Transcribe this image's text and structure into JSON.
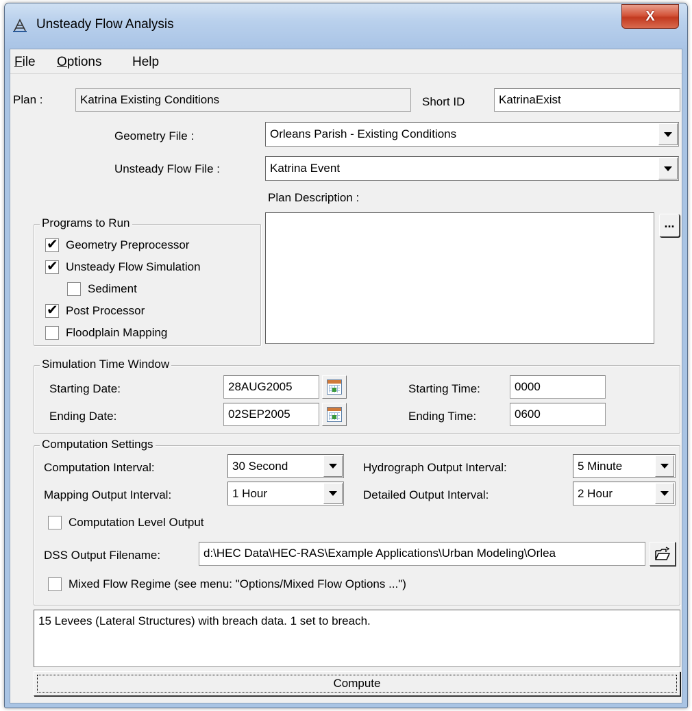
{
  "window": {
    "title": "Unsteady Flow Analysis",
    "close_glyph": "X"
  },
  "menu": {
    "file": "File",
    "options": "Options",
    "help": "Help"
  },
  "plan": {
    "plan_label": "Plan :",
    "plan_value": "Katrina Existing Conditions",
    "short_id_label": "Short ID",
    "short_id_value": "KatrinaExist",
    "geometry_label": "Geometry File :",
    "geometry_value": "Orleans Parish - Existing Conditions",
    "unsteady_label": "Unsteady Flow File :",
    "unsteady_value": "Katrina Event",
    "description_label": "Plan Description :",
    "description_value": "",
    "description_button": "..."
  },
  "programs": {
    "title": "Programs to Run",
    "items": [
      {
        "label": "Geometry Preprocessor",
        "checked": true
      },
      {
        "label": "Unsteady Flow Simulation",
        "checked": true
      },
      {
        "label": "Sediment",
        "checked": false
      },
      {
        "label": "Post Processor",
        "checked": true
      },
      {
        "label": "Floodplain Mapping",
        "checked": false
      }
    ]
  },
  "time_window": {
    "title": "Simulation Time Window",
    "start_date_label": "Starting Date:",
    "start_date": "28AUG2005",
    "end_date_label": "Ending Date:",
    "end_date": "02SEP2005",
    "start_time_label": "Starting Time:",
    "start_time": "0000",
    "end_time_label": "Ending Time:",
    "end_time": "0600"
  },
  "computation": {
    "title": "Computation Settings",
    "comp_interval_label": "Computation Interval:",
    "comp_interval": "30 Second",
    "hydro_interval_label": "Hydrograph Output Interval:",
    "hydro_interval": "5 Minute",
    "mapping_interval_label": "Mapping Output Interval:",
    "mapping_interval": "1 Hour",
    "detailed_interval_label": "Detailed Output Interval:",
    "detailed_interval": "2 Hour",
    "level_output_label": "Computation Level Output",
    "level_output_checked": false,
    "dss_label": "DSS Output Filename:",
    "dss_value": "d:\\HEC Data\\HEC-RAS\\Example Applications\\Urban Modeling\\Orlea",
    "mixed_flow_label": "Mixed Flow Regime (see menu: \"Options/Mixed Flow Options ...\")",
    "mixed_flow_checked": false
  },
  "status": {
    "message": "15 Levees (Lateral Structures) with breach data.  1 set to breach."
  },
  "compute_button": "Compute",
  "icons": {
    "app": "hec-ras-icon",
    "calendar": "calendar-icon",
    "folder": "open-folder-icon"
  }
}
